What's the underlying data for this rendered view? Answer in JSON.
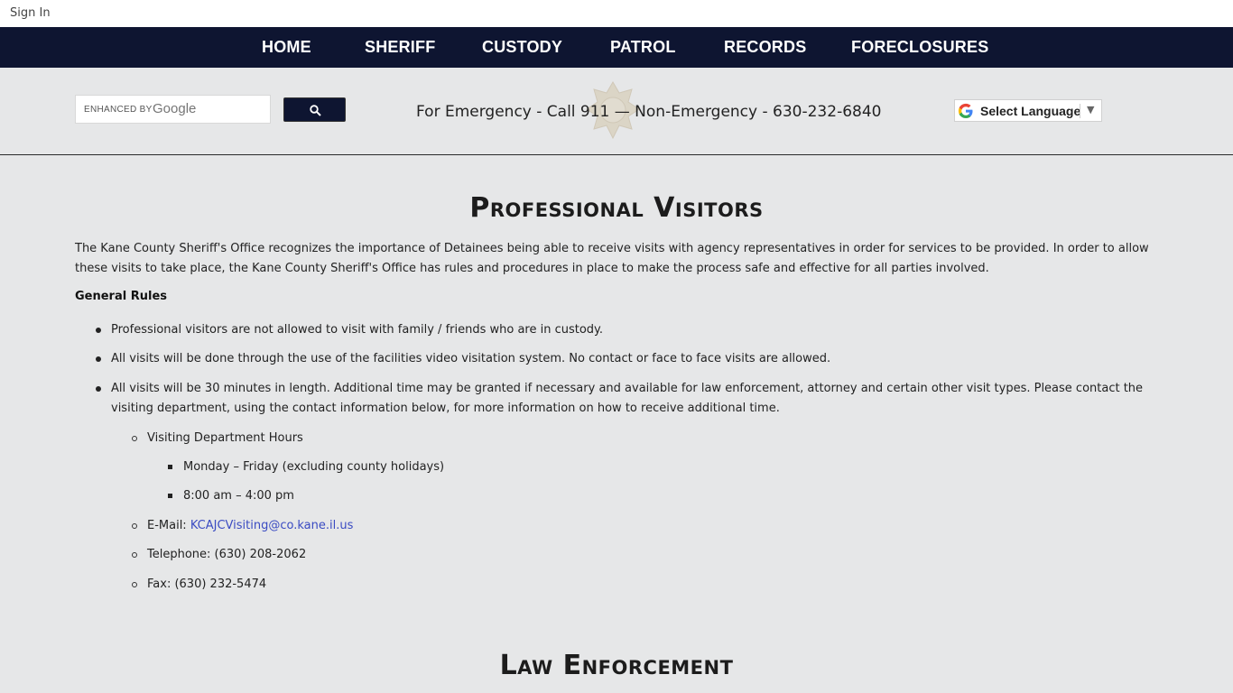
{
  "topbar": {
    "sign_in": "Sign In"
  },
  "nav": {
    "items": [
      "HOME",
      "SHERIFF",
      "CUSTODY",
      "PATROL",
      "RECORDS",
      "FORECLOSURES"
    ]
  },
  "search": {
    "brand_prefix": "ENHANCED BY",
    "brand_logo": "Google",
    "button_icon": "search-icon"
  },
  "emergency_text": "For Emergency - Call 911 — Non-Emergency - 630-232-6840",
  "translate": {
    "label": "Select Language",
    "arrow": "▼"
  },
  "main": {
    "title": "Professional Visitors",
    "intro": "The Kane County Sheriff's Office recognizes the importance of Detainees being able to receive visits with agency representatives in order for services to be provided.  In order to allow these visits to take place, the Kane County Sheriff's Office has rules and procedures in place to make the process safe and effective for all parties involved.",
    "rules_heading": "General Rules",
    "rules": [
      "Professional visitors are not allowed to visit with family / friends who are in custody.",
      "All visits will be done through the use of the facilities video visitation system. No contact or face to face visits are allowed.",
      "All visits will be 30 minutes in length. Additional time may be granted if necessary and available for law enforcement, attorney and certain other visit types. Please contact the visiting department, using the contact information below, for more information on how to receive additional time."
    ],
    "contact": {
      "hours_label": "Visiting Department Hours",
      "hours": [
        "Monday – Friday (excluding county holidays)",
        "8:00 am – 4:00 pm"
      ],
      "email_label": "E-Mail: ",
      "email": "KCAJCVisiting@co.kane.il.us",
      "telephone": "Telephone: (630) 208-2062",
      "fax": "Fax: (630) 232-5474"
    },
    "next_section_title": "Law Enforcement"
  },
  "colors": {
    "nav_bg": "#0e1531",
    "page_bg": "#e6e7e8",
    "link": "#3a4bc2"
  }
}
